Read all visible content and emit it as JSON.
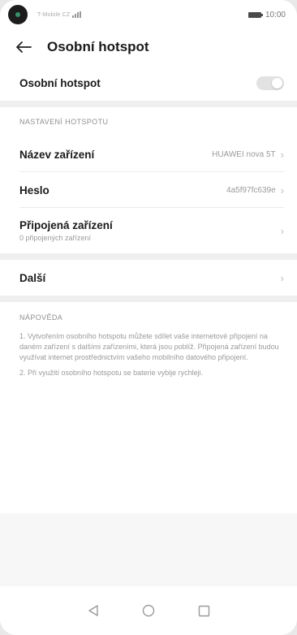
{
  "status_bar": {
    "carrier": "T-Mobile CZ",
    "time": "10:00"
  },
  "header": {
    "title": "Osobní hotspot"
  },
  "hotspot_toggle": {
    "label": "Osobní hotspot",
    "state": "off"
  },
  "settings": {
    "section_title": "NASTAVENÍ HOTSPOTU",
    "device_name": {
      "label": "Název zařízení",
      "value": "HUAWEI nova 5T"
    },
    "password": {
      "label": "Heslo",
      "value": "4a5f97fc639e"
    },
    "connected": {
      "label": "Připojená zařízení",
      "sub": "0 připojených zařízení"
    }
  },
  "more": {
    "label": "Další"
  },
  "help": {
    "title": "NÁPOVĚDA",
    "p1": "1. Vytvořením osobního hotspotu můžete sdílet vaše internetové připojení na daném zařízení s dalšími zařízeními, která jsou poblíž. Připojená zařízení budou využívat internet prostřednictvím vašeho mobilního datového připojení.",
    "p2": "2. Při využití osobního hotspotu se baterie vybije rychleji."
  },
  "icons": {
    "back": "back-arrow-icon",
    "chevron": "chevron-right-icon",
    "nav_back": "nav-back-icon",
    "nav_home": "nav-home-icon",
    "nav_recents": "nav-recents-icon"
  }
}
